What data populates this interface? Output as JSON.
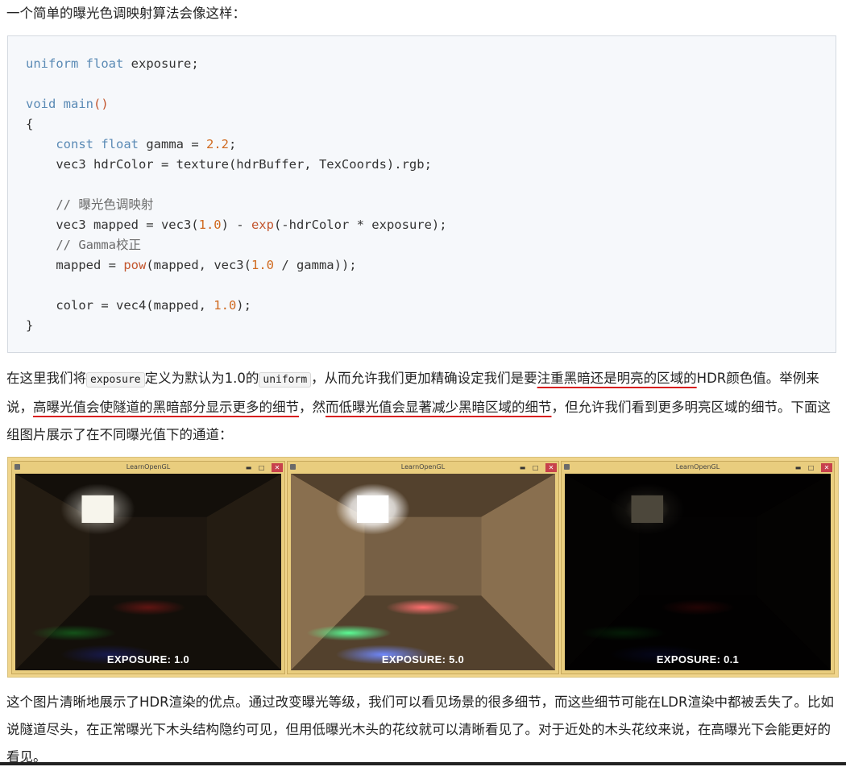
{
  "intro_text": "一个简单的曝光色调映射算法会像这样：",
  "code": {
    "l1_kw": "uniform",
    "l1_type": "float",
    "l1_rest": " exposure;",
    "l3_kw": "void",
    "l3_fn": "main",
    "l3_paren": "()",
    "l4": "{",
    "l5_kw": "const",
    "l5_type": "float",
    "l5_mid": " gamma = ",
    "l5_num": "2.2",
    "l5_end": ";",
    "l6": "vec3 hdrColor = texture(hdrBuffer, TexCoords).rgb;",
    "l8": "// 曝光色调映射",
    "l9_a": "vec3 mapped = vec3(",
    "l9_num1": "1.0",
    "l9_b": ") - ",
    "l9_fn": "exp",
    "l9_c": "(-hdrColor * exposure);",
    "l10": "// Gamma校正",
    "l11_a": "mapped = ",
    "l11_fn": "pow",
    "l11_b": "(mapped, vec3(",
    "l11_num": "1.0",
    "l11_c": " / gamma));",
    "l13_a": "color = vec4(mapped, ",
    "l13_num": "1.0",
    "l13_b": ");",
    "l14": "}"
  },
  "explain": {
    "p1": "在这里我们将",
    "code1": "exposure",
    "p2": "定义为默认为1.0的",
    "code2": "uniform",
    "p3": "，从而允许我们更加精确设定我们是要",
    "hl1": "注重黑暗还是明亮的区域的",
    "p4": "HDR颜色值。举例来说，",
    "hl2": "高曝光值会使隧道的黑暗部分显示更多的细节",
    "p5": "，然",
    "hl3": "而低曝光值会显著减少黑暗区域的细节",
    "p6": "，但允许我们看到更多明亮区域的细节。下面这组图片展示了在不同曝光值下的通道："
  },
  "screenshots": [
    {
      "window_title": "LearnOpenGL",
      "label": "EXPOSURE: 1.0",
      "exposure": 1.0
    },
    {
      "window_title": "LearnOpenGL",
      "label": "EXPOSURE: 5.0",
      "exposure": 5.0
    },
    {
      "window_title": "LearnOpenGL",
      "label": "EXPOSURE: 0.1",
      "exposure": 0.1
    }
  ],
  "window_controls": {
    "minimize": "▬",
    "maximize": "□",
    "close": "✕"
  },
  "summary_text": "这个图片清晰地展示了HDR渲染的优点。通过改变曝光等级，我们可以看见场景的很多细节，而这些细节可能在LDR渲染中都被丢失了。比如说隧道尽头，在正常曝光下木头结构隐约可见，但用低曝光木头的花纹就可以清晰看见了。对于近处的木头花纹来说，在高曝光下会能更好的看见。",
  "colors": {
    "underline": "#d81f1f",
    "code_bg": "#f6f8fb",
    "keyword": "#5a8ab5",
    "function": "#c3562e",
    "number": "#d06a20",
    "frame": "#f0d58c"
  }
}
